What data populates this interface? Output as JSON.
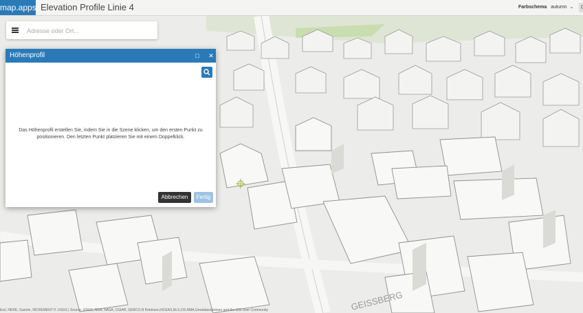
{
  "topbar": {
    "brand": "map.apps",
    "title": "Elevation Profile Linie 4",
    "scheme_label": "Farbschema",
    "scheme_value": "autumn",
    "edge_label": "C"
  },
  "search": {
    "placeholder": "Adresse oder Ort..."
  },
  "dialog": {
    "title": "Höhenprofil",
    "instruction": "Das Höhenprofil erstellen Sie, indem Sie in die Szene klicken, um den ersten Punkt zu positionieren. Den letzten Punkt platzieren Sie mit einem Doppelklick.",
    "cancel_label": "Abbrechen",
    "done_label": "Fertig"
  },
  "map": {
    "street_label": "GEISSBERG",
    "bg_color": "#ececea"
  },
  "attribution": "Esri, HERE, Garmin, INCREMENT P, USGS | Source: USGS, NGA, NASA, CGIAR, GEBCO,N Robinson,NCEAS,NLS,OS,NMA,Geodatastyrelsen and the GIS User Community"
}
